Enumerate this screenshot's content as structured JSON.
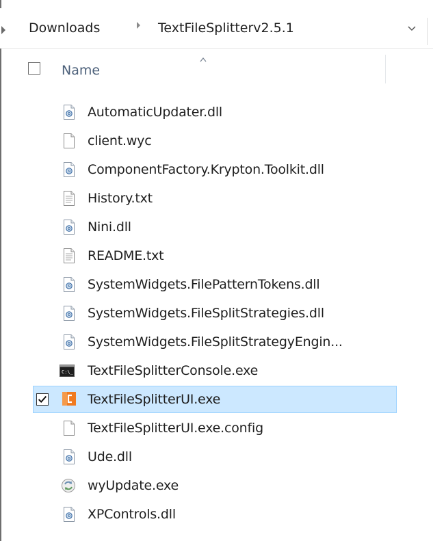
{
  "address_bar": {
    "crumbs": [
      "Downloads",
      "TextFileSplitterv2.5.1"
    ]
  },
  "header": {
    "name_label": "Name"
  },
  "files": [
    {
      "name": "AutomaticUpdater.dll",
      "icon": "dll-file-icon",
      "selected": false
    },
    {
      "name": "client.wyc",
      "icon": "blank-file-icon",
      "selected": false
    },
    {
      "name": "ComponentFactory.Krypton.Toolkit.dll",
      "icon": "dll-file-icon",
      "selected": false
    },
    {
      "name": "History.txt",
      "icon": "text-file-icon",
      "selected": false
    },
    {
      "name": "Nini.dll",
      "icon": "dll-file-icon",
      "selected": false
    },
    {
      "name": "README.txt",
      "icon": "text-file-icon",
      "selected": false
    },
    {
      "name": "SystemWidgets.FilePatternTokens.dll",
      "icon": "dll-file-icon",
      "selected": false
    },
    {
      "name": "SystemWidgets.FileSplitStrategies.dll",
      "icon": "dll-file-icon",
      "selected": false
    },
    {
      "name": "SystemWidgets.FileSplitStrategyEngin...",
      "icon": "dll-file-icon",
      "selected": false
    },
    {
      "name": "TextFileSplitterConsole.exe",
      "icon": "console-app-icon",
      "selected": false
    },
    {
      "name": "TextFileSplitterUI.exe",
      "icon": "splitter-app-icon",
      "selected": true
    },
    {
      "name": "TextFileSplitterUI.exe.config",
      "icon": "blank-file-icon",
      "selected": false
    },
    {
      "name": "Ude.dll",
      "icon": "dll-file-icon",
      "selected": false
    },
    {
      "name": "wyUpdate.exe",
      "icon": "update-app-icon",
      "selected": false
    },
    {
      "name": "XPControls.dll",
      "icon": "dll-file-icon",
      "selected": false
    }
  ],
  "colors": {
    "selection_bg": "#cce8ff",
    "selection_border": "#99d1ff",
    "header_text": "#4c607a"
  }
}
